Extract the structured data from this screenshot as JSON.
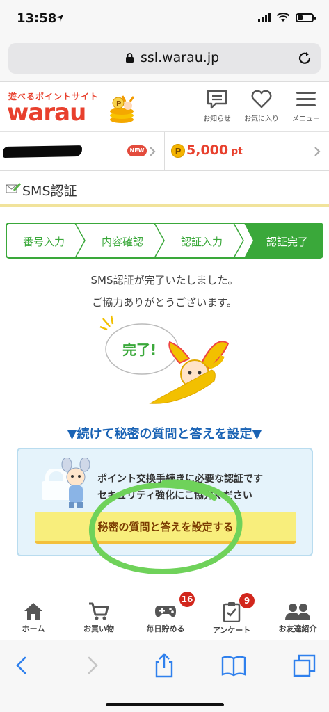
{
  "status": {
    "time": "13:58"
  },
  "browser": {
    "url": "ssl.warau.jp"
  },
  "header": {
    "logo_tagline": "遊べるポイントサイト",
    "logo_text": "warau",
    "notice_label": "お知らせ",
    "favorites_label": "お気に入り",
    "menu_label": "メニュー"
  },
  "user": {
    "new_badge": "NEW",
    "points_value": "5,000",
    "points_unit": "pt"
  },
  "page": {
    "title": "SMS認証"
  },
  "steps": [
    {
      "label": "番号入力"
    },
    {
      "label": "内容確認"
    },
    {
      "label": "認証入力"
    },
    {
      "label": "認証完了"
    }
  ],
  "message": {
    "line1": "SMS認証が完了いたしました。",
    "line2": "ご協力ありがとうございます。",
    "bubble": "完了!"
  },
  "continue_heading": "▼続けて秘密の質問と答えを設定▼",
  "promo": {
    "line1": "ポイント交換手続きに必要な認証です",
    "line2": "セキュリティ強化にご協力ください",
    "cta": "秘密の質問と答えを設定する"
  },
  "tabbar": [
    {
      "label": "ホーム",
      "icon": "home-icon"
    },
    {
      "label": "お買い物",
      "icon": "cart-icon"
    },
    {
      "label": "毎日貯める",
      "icon": "gamepad-icon",
      "badge": "16"
    },
    {
      "label": "アンケート",
      "icon": "clipboard-icon",
      "badge": "9"
    },
    {
      "label": "お友達紹介",
      "icon": "friends-icon"
    }
  ],
  "colors": {
    "brand_red": "#e8402d",
    "step_green": "#3aa83a",
    "link_blue": "#1a63b5",
    "cta_yellow": "#f8ee7c",
    "highlight_scribble": "#6fd25a"
  }
}
